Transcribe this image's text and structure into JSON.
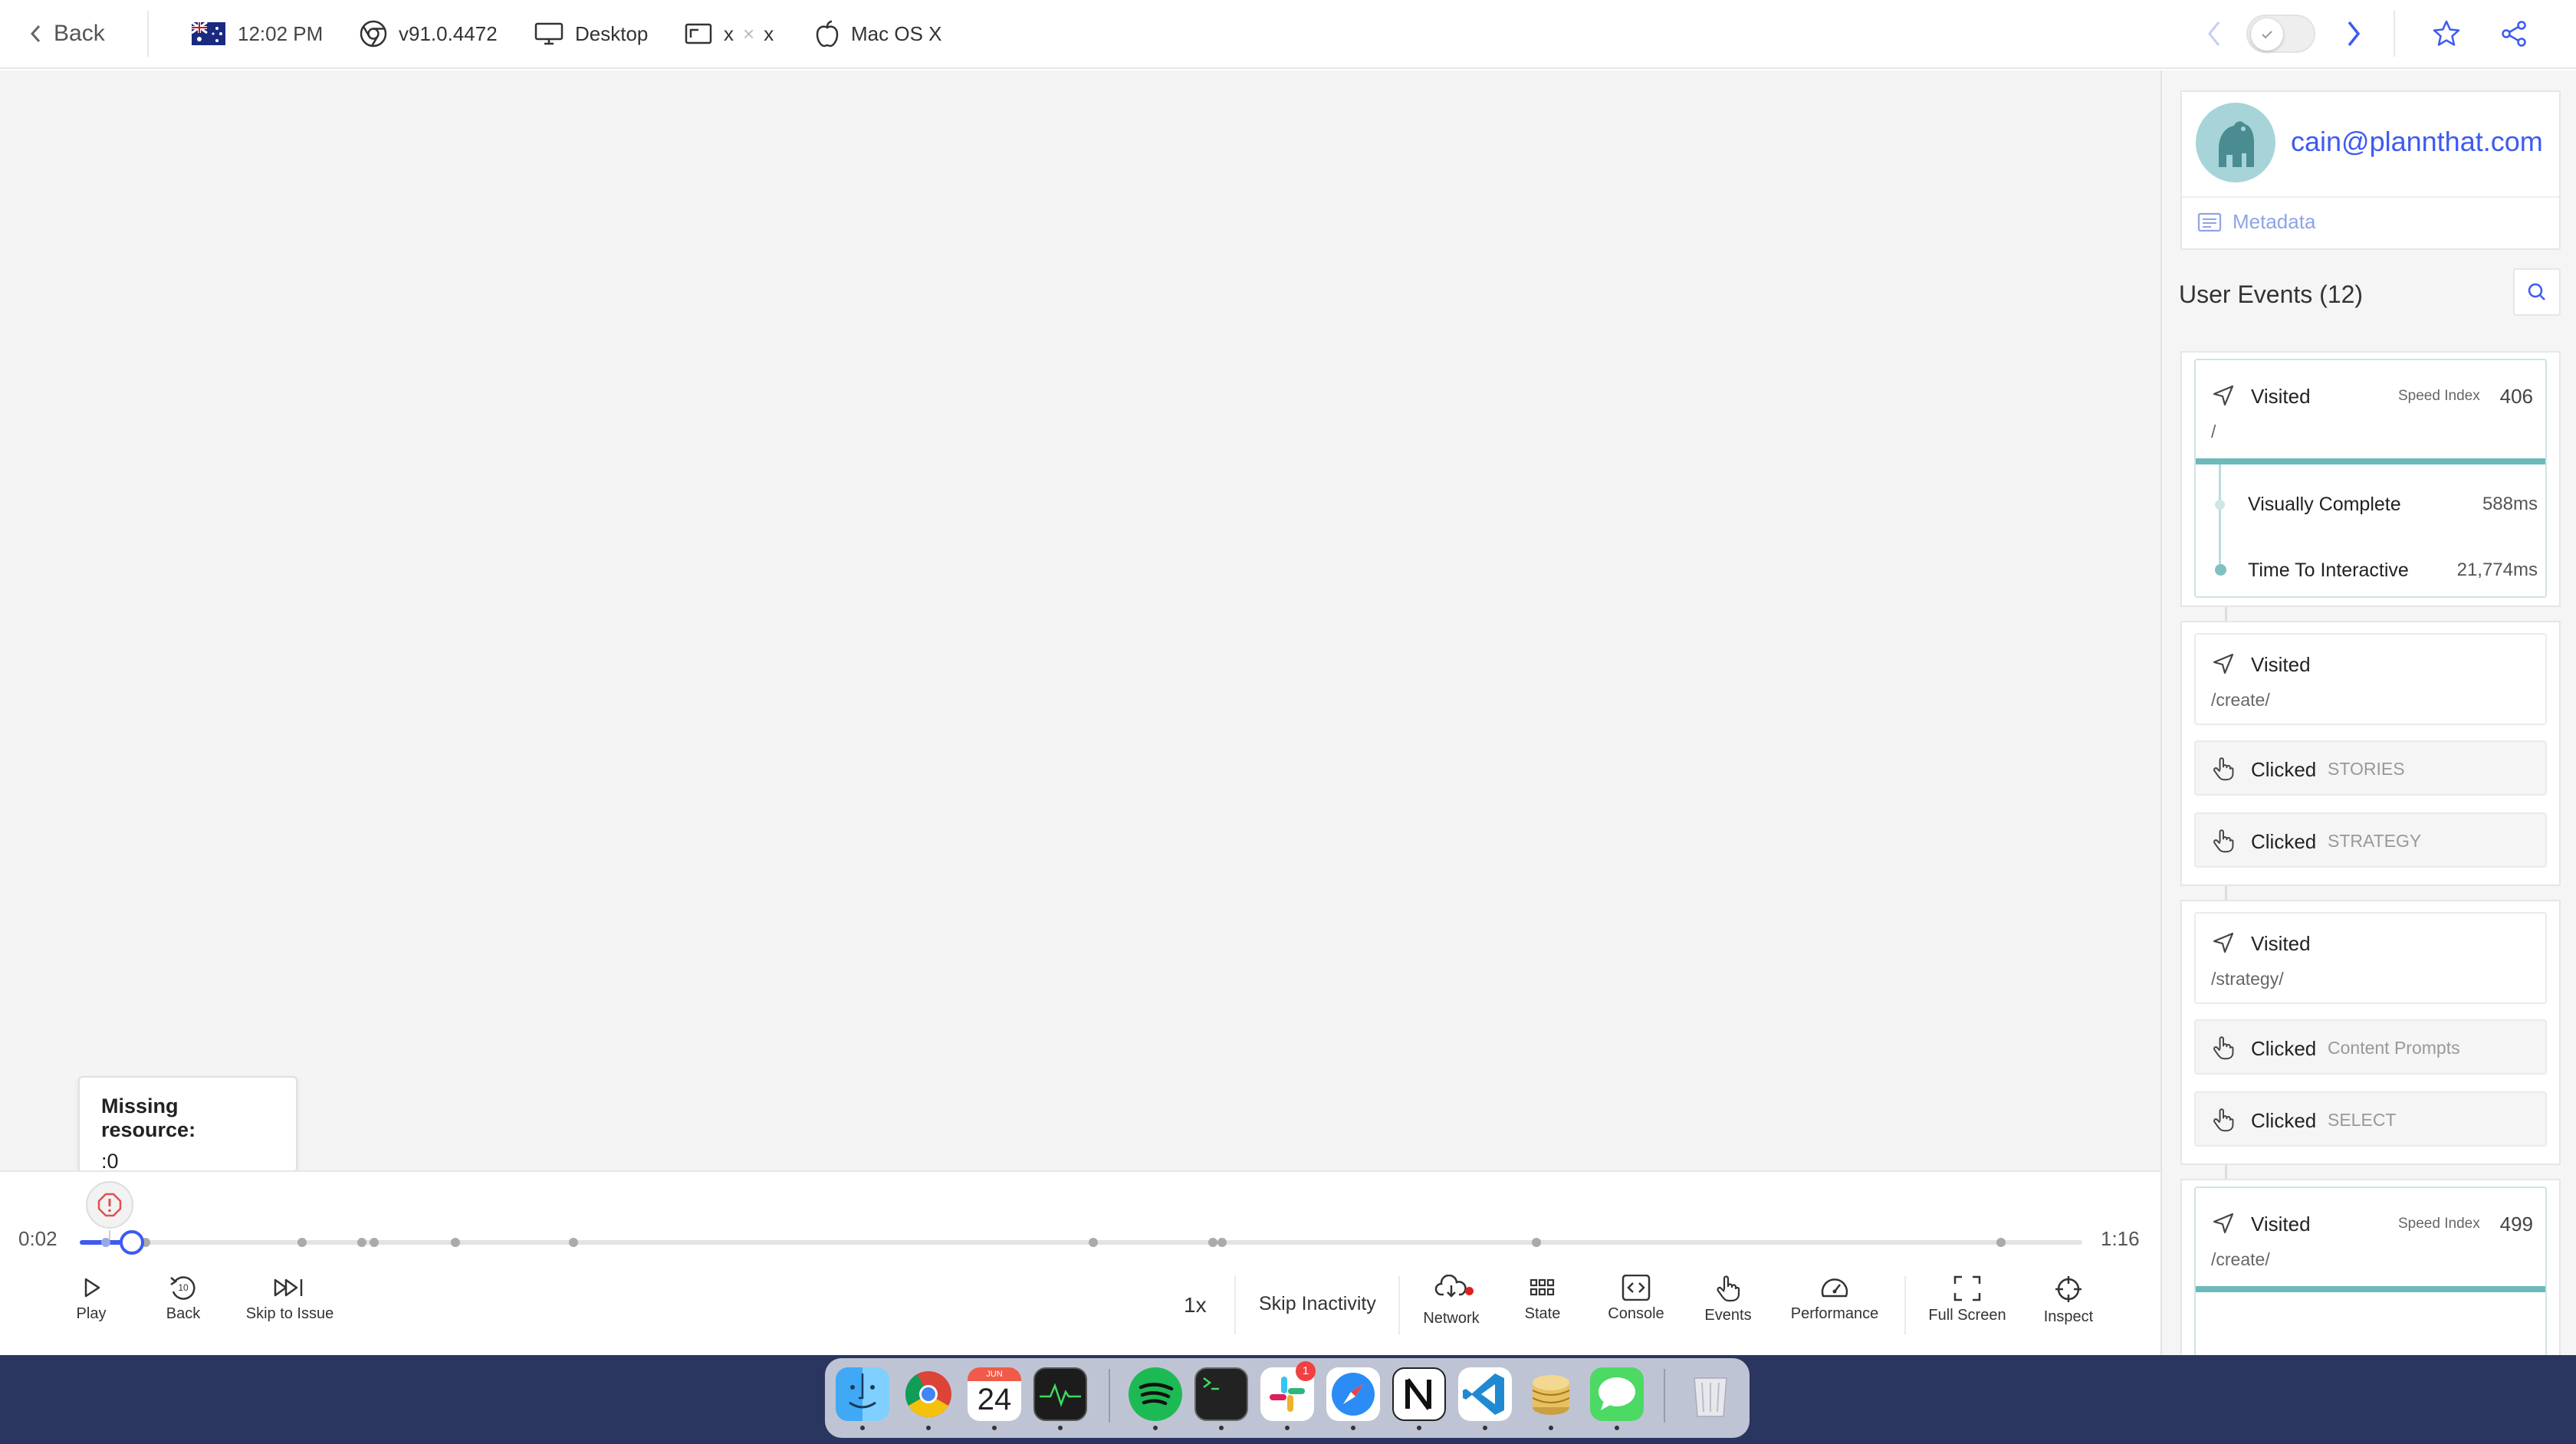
{
  "topbar": {
    "back_label": "Back",
    "time": "12:02 PM",
    "browser_version": "v91.0.4472",
    "device": "Desktop",
    "resolution_w": "x",
    "resolution_sep": "×",
    "resolution_h": "x",
    "os": "Mac OS X"
  },
  "player": {
    "tooltip_title": "Missing resource:",
    "tooltip_value": ":0",
    "current_time": "0:02",
    "total_time": "1:16",
    "progress_fraction": 0.026
  },
  "controls": {
    "play": "Play",
    "back": "Back",
    "back_seconds": "10",
    "skip_issue": "Skip to Issue",
    "speed": "1x",
    "skip_inactivity": "Skip Inactivity",
    "network": "Network",
    "state": "State",
    "console": "Console",
    "events": "Events",
    "performance": "Performance",
    "fullscreen": "Full Screen",
    "inspect": "Inspect"
  },
  "sidebar": {
    "user_email": "cain@plannthat.com",
    "metadata_label": "Metadata",
    "events_title": "User Events (12)",
    "groups": [
      {
        "visited_label": "Visited",
        "path": "/",
        "speed_index_label": "Speed Index",
        "speed_index_value": "406",
        "metrics": [
          {
            "label": "Visually Complete",
            "value": "588ms"
          },
          {
            "label": "Time To Interactive",
            "value": "21,774ms"
          }
        ]
      },
      {
        "visited_label": "Visited",
        "path": "/create/",
        "clicks": [
          {
            "label": "Clicked",
            "target": "STORIES"
          },
          {
            "label": "Clicked",
            "target": "STRATEGY"
          }
        ]
      },
      {
        "visited_label": "Visited",
        "path": "/strategy/",
        "clicks": [
          {
            "label": "Clicked",
            "target": "Content Prompts"
          },
          {
            "label": "Clicked",
            "target": "SELECT"
          }
        ]
      },
      {
        "visited_label": "Visited",
        "path": "/create/",
        "speed_index_label": "Speed Index",
        "speed_index_value": "499"
      }
    ]
  },
  "dock": {
    "calendar_month": "JUN",
    "calendar_day": "24",
    "slack_badge": "1",
    "apps": [
      "finder-icon",
      "chrome-icon",
      "calendar-icon",
      "activity-monitor-icon",
      "spotify-icon",
      "terminal-icon",
      "slack-icon",
      "safari-icon",
      "notion-icon",
      "vscode-icon",
      "sequel-pro-icon",
      "messages-icon",
      "trash-icon"
    ]
  },
  "colors": {
    "accent": "#3d5af1",
    "teal": "#4aa8a8",
    "issue_red": "#e05050",
    "dock_bg": "#2a3660"
  }
}
